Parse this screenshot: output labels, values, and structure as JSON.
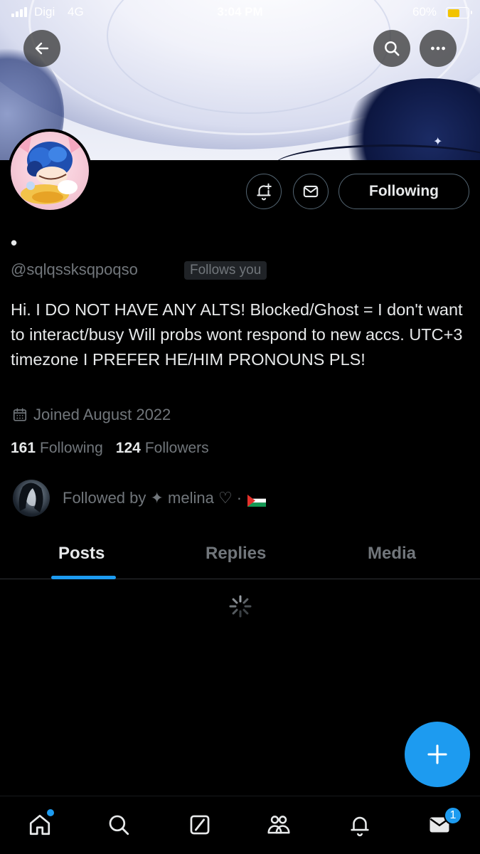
{
  "status_bar": {
    "carrier": "Digi",
    "network": "4G",
    "time": "3:04 PM",
    "battery_percent": "60%",
    "battery_level": 0.6
  },
  "header": {
    "back_icon": "arrow-left-icon",
    "search_icon": "search-icon",
    "more_icon": "more-horizontal-icon"
  },
  "profile": {
    "display_name": "•",
    "handle": "@sqlqssksqpoqso",
    "follows_you_label": "Follows you",
    "bio": "Hi. I DO NOT HAVE ANY ALTS! Blocked/Ghost = I don't want to interact/busy Will probs wont respond to new accs. UTC+3 timezone I PREFER HE/HIM PRONOUNS PLS!",
    "joined": "Joined August 2022",
    "following_count": "161",
    "following_label": "Following",
    "followers_count": "124",
    "followers_label": "Followers",
    "followed_by": "Followed by ✦ melina ♡ ·"
  },
  "actions": {
    "notify_icon": "bell-plus-icon",
    "message_icon": "envelope-icon",
    "following_button": "Following"
  },
  "tabs": [
    {
      "label": "Posts",
      "active": true
    },
    {
      "label": "Replies",
      "active": false
    },
    {
      "label": "Media",
      "active": false
    }
  ],
  "bottom_nav": {
    "items": [
      "home-icon",
      "search-icon",
      "grok-icon",
      "communities-icon",
      "notifications-icon",
      "messages-icon"
    ],
    "messages_badge": "1"
  },
  "colors": {
    "accent": "#1d9bf0",
    "background": "#000000",
    "muted_text": "#71767b",
    "primary_text": "#e7e9ea",
    "border": "#536471"
  }
}
